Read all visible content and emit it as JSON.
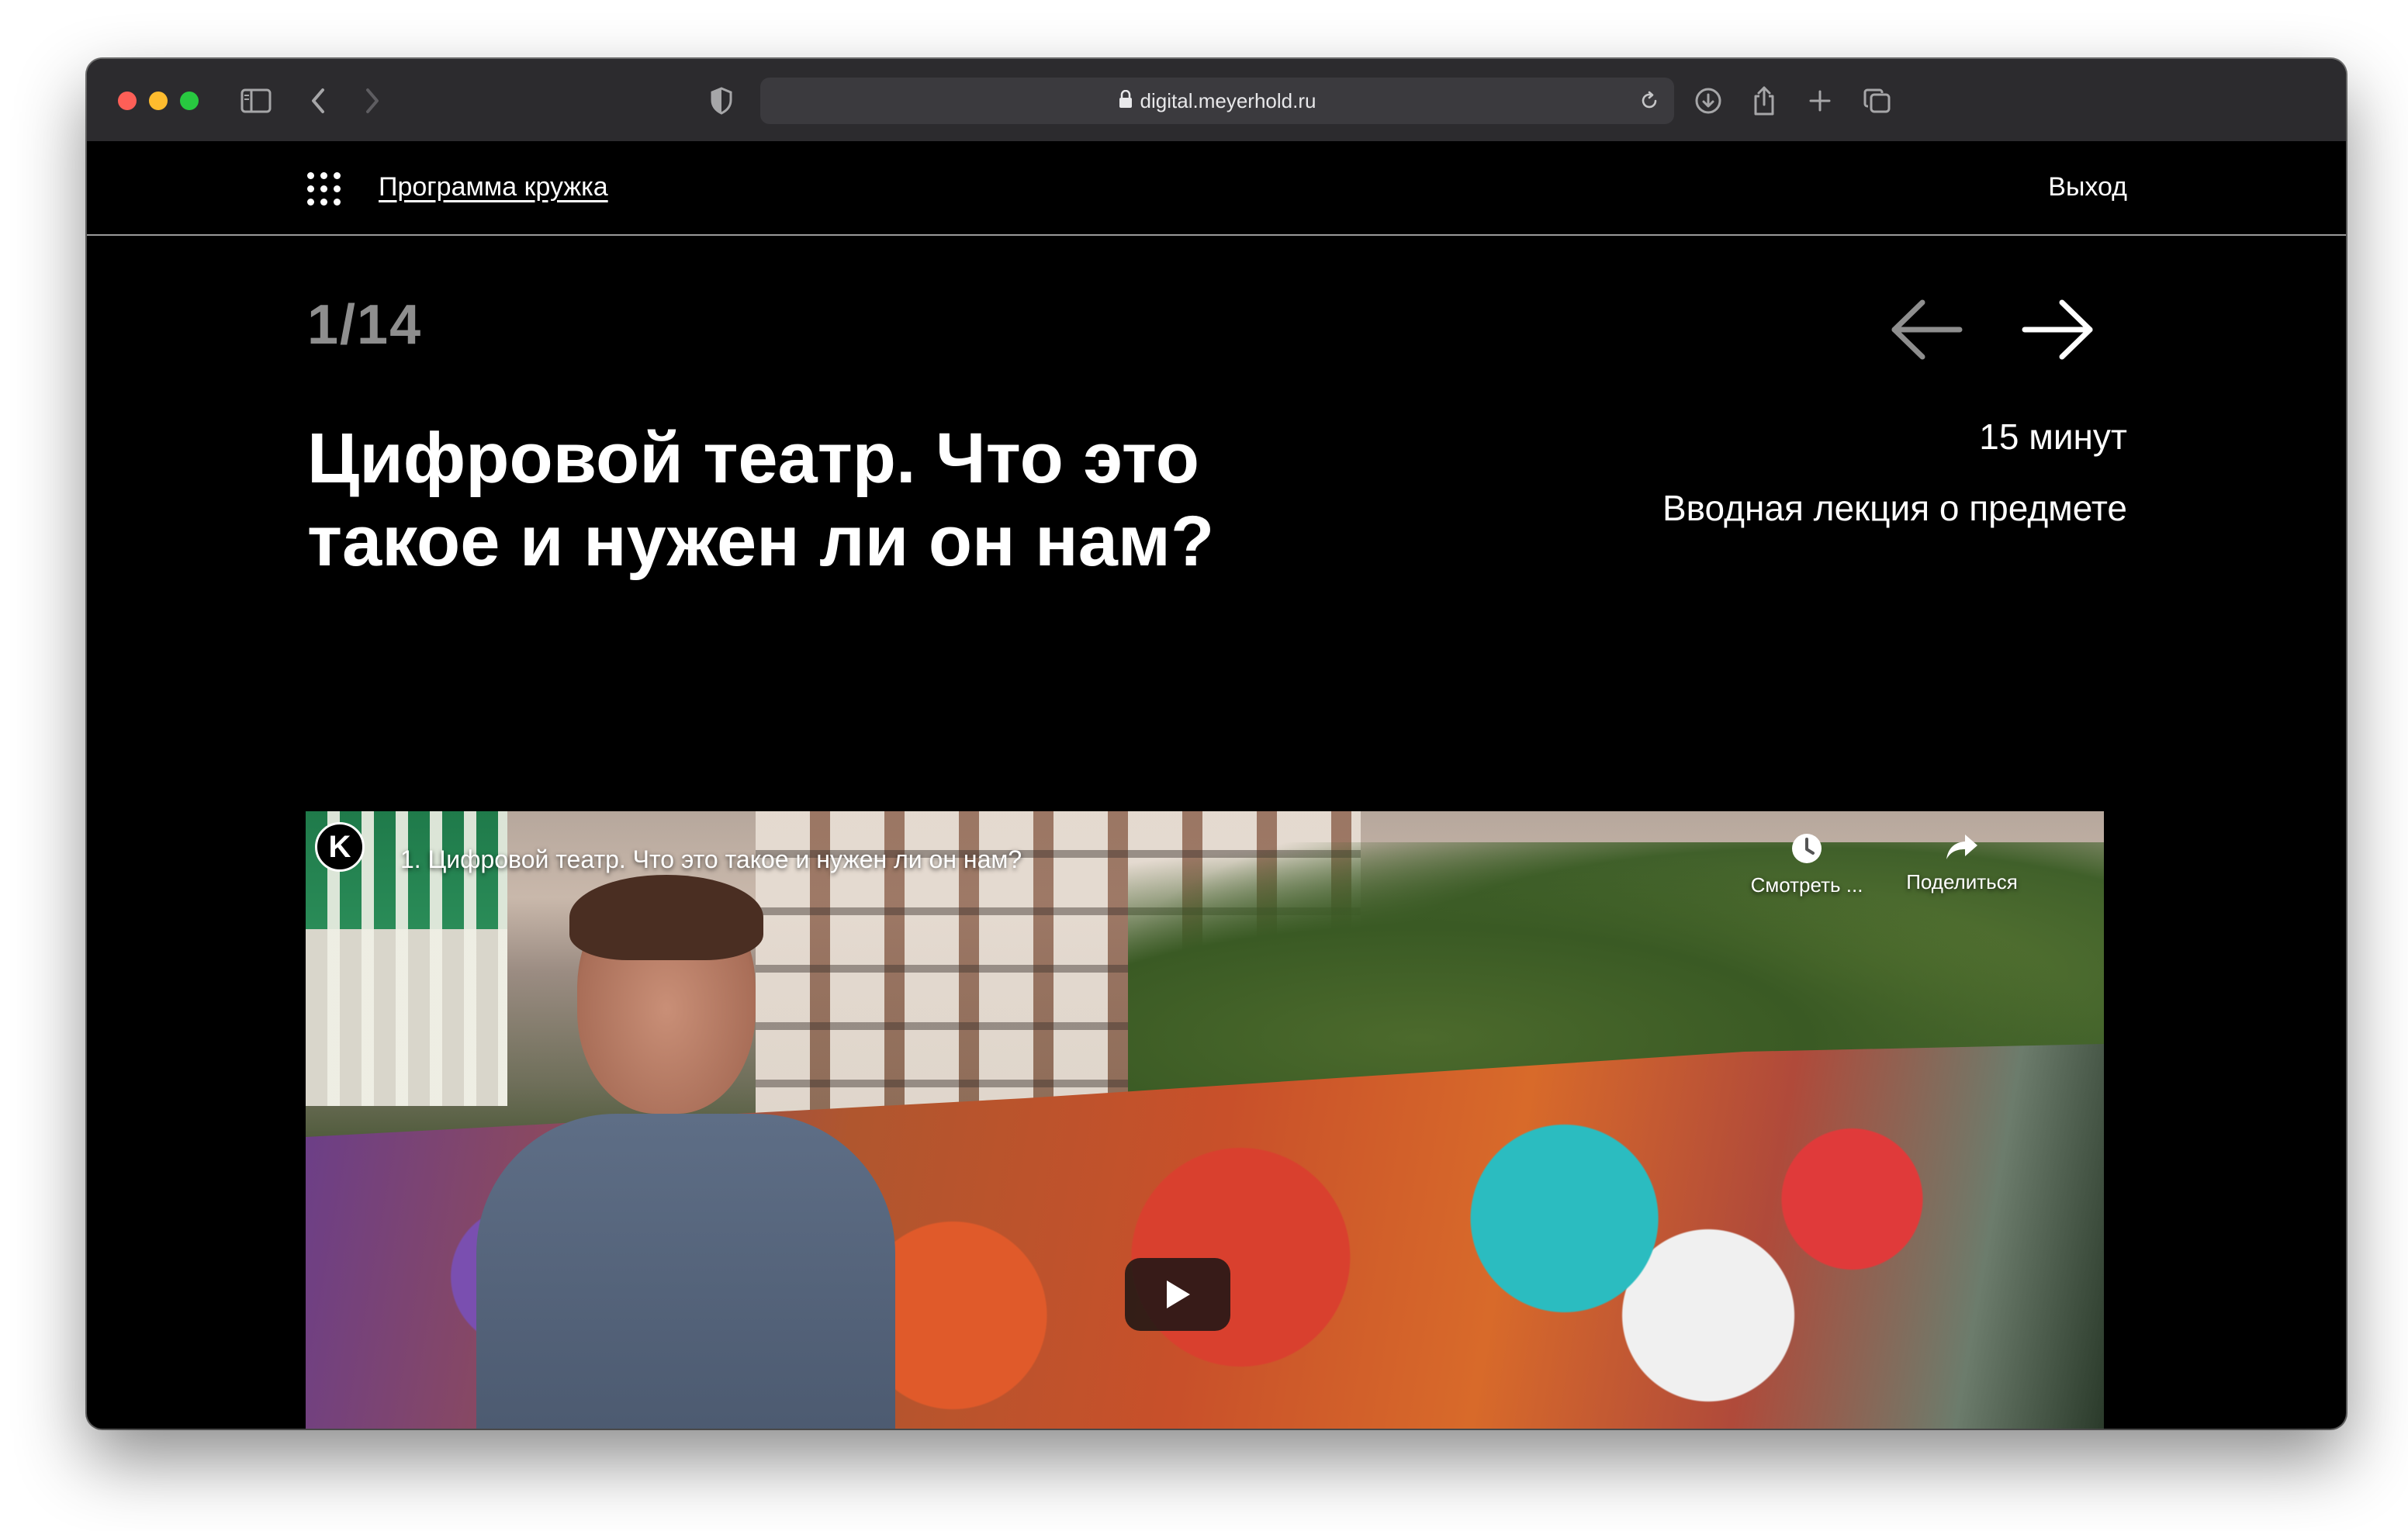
{
  "browser": {
    "url": "digital.meyerhold.ru",
    "icons": [
      "sidebar-icon",
      "back-icon",
      "forward-icon",
      "shield-icon",
      "lock-icon",
      "reload-icon",
      "download-icon",
      "share-icon",
      "new-tab-icon",
      "tabs-icon"
    ]
  },
  "site": {
    "nav_link": "Программа кружка",
    "logout": "Выход"
  },
  "lesson": {
    "counter": "1/14",
    "title": "Цифровой театр. Что это такое и нужен ли он нам?",
    "duration": "15 минут",
    "description": "Вводная лекция о предмете"
  },
  "video": {
    "channel_letter": "K",
    "title": "1. Цифровой театр. Что это такое и нужен ли он нам?",
    "watch_later": "Смотреть ...",
    "share": "Поделиться"
  },
  "colors": {
    "page_bg": "#000000",
    "text": "#ffffff",
    "counter": "#8e8e8e",
    "arrow_inactive": "#8e8e8e",
    "browser_chrome": "#2c2b2e",
    "address_bar": "#3b3a3e"
  }
}
